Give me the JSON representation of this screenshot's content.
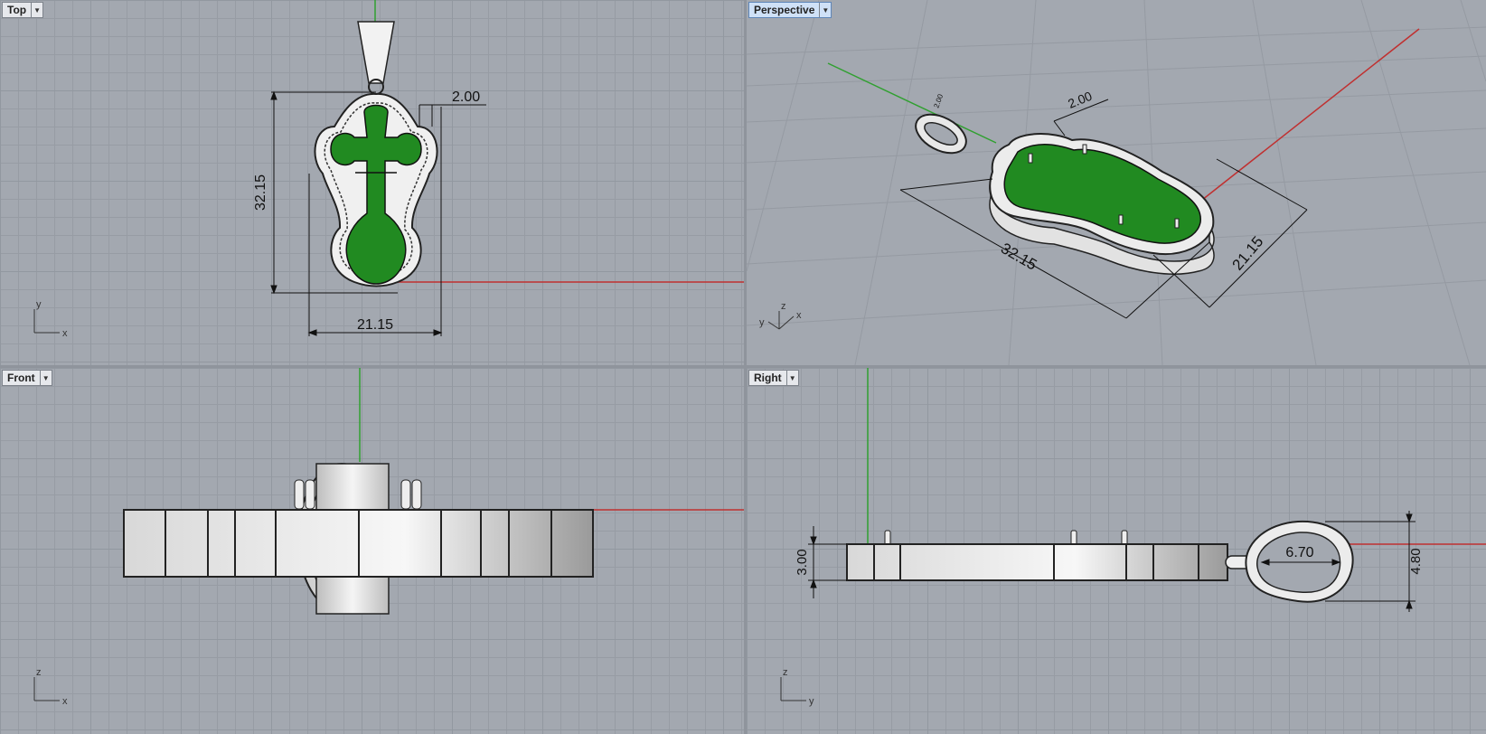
{
  "viewports": {
    "top": {
      "title": "Top",
      "dropdown_icon": "triangle-down",
      "dims": {
        "height": "32.15",
        "width": "21.15",
        "thickness": "2.00"
      },
      "axes": {
        "x": "x",
        "y": "y"
      }
    },
    "persp": {
      "title": "Perspective",
      "dropdown_icon": "triangle-down",
      "active": true,
      "dims": {
        "length": "32.15",
        "width": "21.15",
        "thickness": "2.00",
        "small": "2.00"
      },
      "axes": {
        "x": "x",
        "y": "y",
        "z": "z"
      }
    },
    "front": {
      "title": "Front",
      "dropdown_icon": "triangle-down",
      "axes": {
        "x": "x",
        "z": "z"
      }
    },
    "right": {
      "title": "Right",
      "dropdown_icon": "triangle-down",
      "dims": {
        "thickness": "3.00",
        "loop_length": "6.70",
        "loop_height": "4.80"
      },
      "axes": {
        "y": "y",
        "z": "z"
      }
    }
  },
  "colors": {
    "viewport_bg": "#a3a8b0",
    "x_axis": "#c03030",
    "y_axis": "#30a030",
    "enamel": "#218a21",
    "active_title": "#cfe1f7"
  }
}
